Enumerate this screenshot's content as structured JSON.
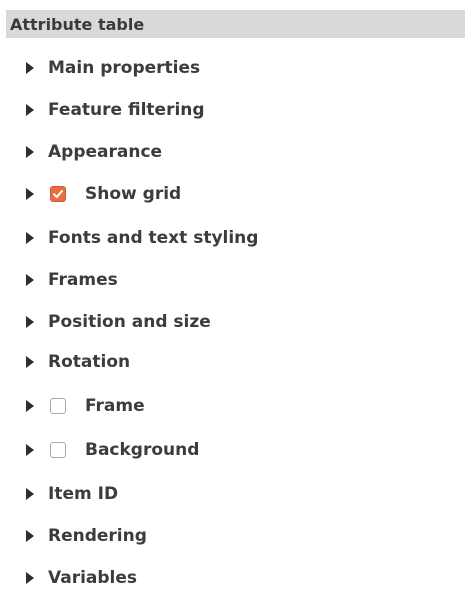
{
  "panel": {
    "title": "Attribute table"
  },
  "sections": [
    {
      "label": "Main properties",
      "checkbox": null
    },
    {
      "label": "Feature filtering",
      "checkbox": null
    },
    {
      "label": "Appearance",
      "checkbox": null
    },
    {
      "label": "Show grid",
      "checkbox": "checked"
    },
    {
      "label": "Fonts and text styling",
      "checkbox": null
    },
    {
      "label": "Frames",
      "checkbox": null
    },
    {
      "label": "Position and size",
      "checkbox": null
    },
    {
      "label": "Rotation",
      "checkbox": null
    },
    {
      "label": "Frame",
      "checkbox": "unchecked"
    },
    {
      "label": "Background",
      "checkbox": "unchecked"
    },
    {
      "label": "Item ID",
      "checkbox": null
    },
    {
      "label": "Rendering",
      "checkbox": null
    },
    {
      "label": "Variables",
      "checkbox": null
    }
  ],
  "icons": {
    "expand": "triangle-right-icon",
    "check": "checkmark-icon"
  },
  "colors": {
    "header_bg": "#d9d9d9",
    "checkbox_checked": "#e96d43",
    "text": "#3c3c3c"
  }
}
